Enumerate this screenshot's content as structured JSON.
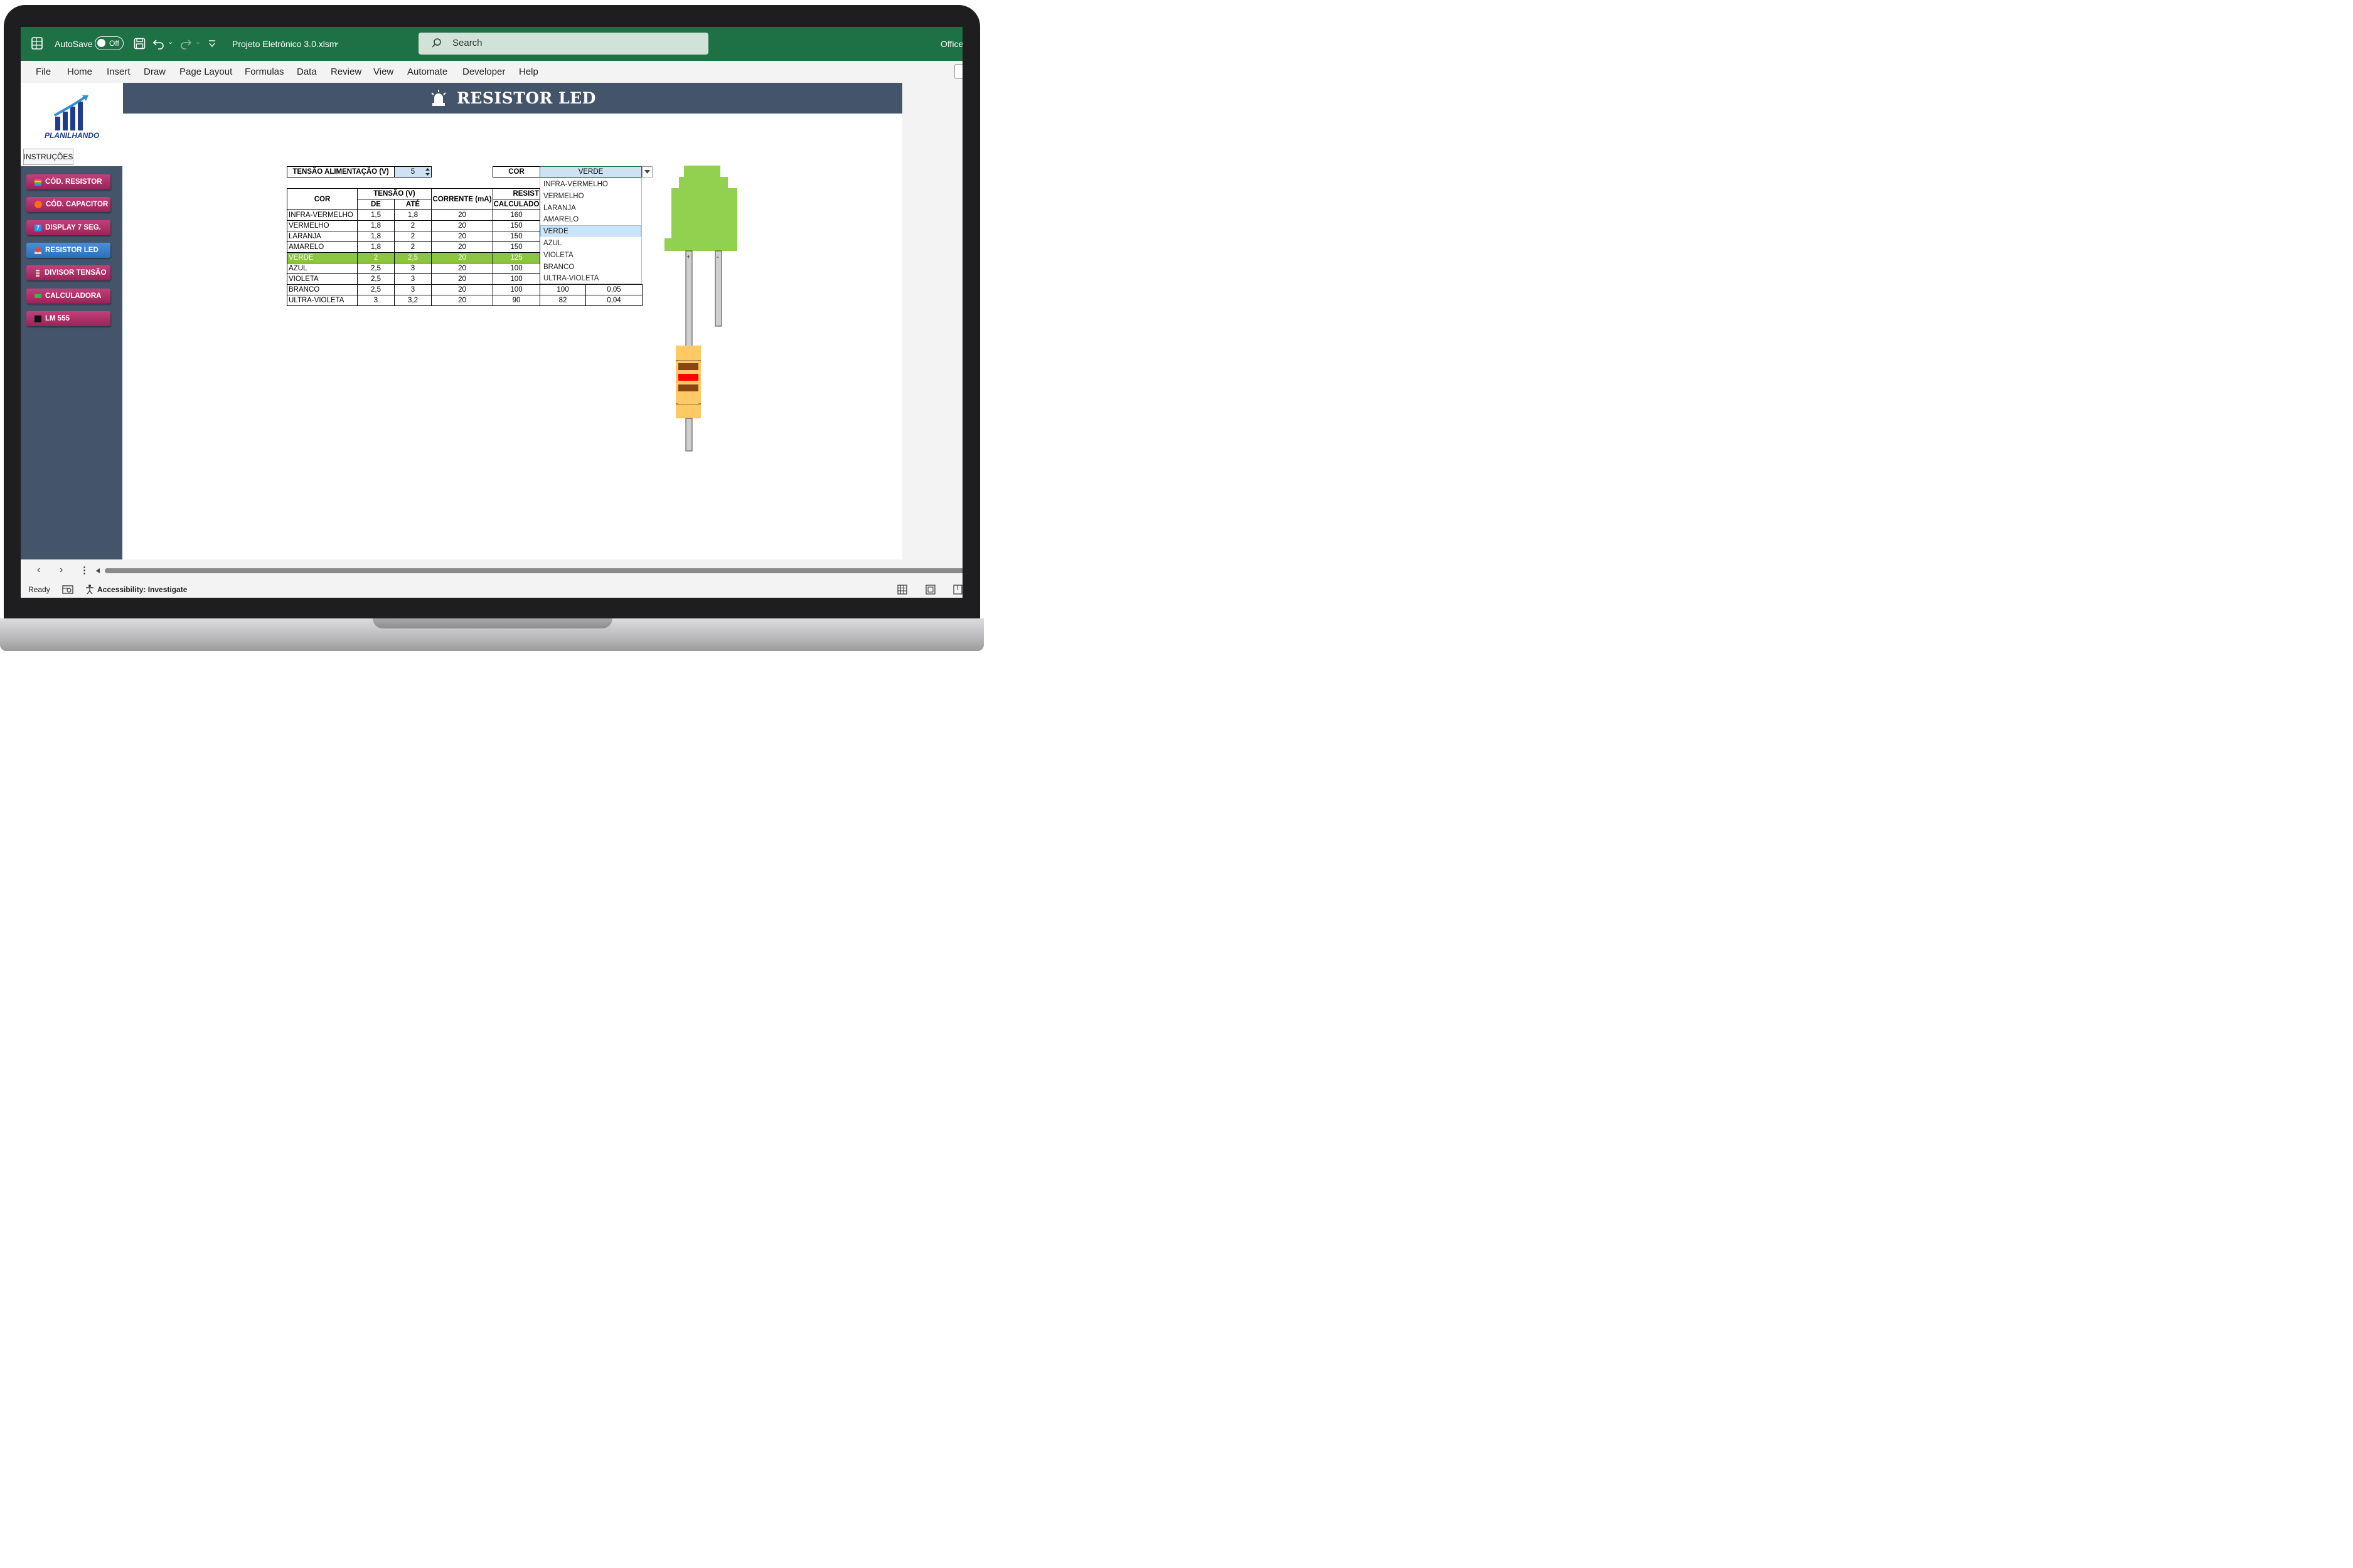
{
  "titlebar": {
    "autosave_label": "AutoSave",
    "autosave_state": "Off",
    "filename": "Projeto Eletrônico 3.0.xlsm",
    "search_placeholder": "Search",
    "account": "Office"
  },
  "menu": [
    "File",
    "Home",
    "Insert",
    "Draw",
    "Page Layout",
    "Formulas",
    "Data",
    "Review",
    "View",
    "Automate",
    "Developer",
    "Help"
  ],
  "logo_text": "PLANILHANDO",
  "instructions_button": "INSTRUÇÕES",
  "nav": [
    {
      "label": "CÓD. RESISTOR",
      "icon": "rainbow-icon"
    },
    {
      "label": "CÓD. CAPACITOR",
      "icon": "orange-dot-icon"
    },
    {
      "label": "DISPLAY 7 SEG.",
      "icon": "seven-icon",
      "icon_text": "7"
    },
    {
      "label": "RESISTOR LED",
      "icon": "siren-icon",
      "active": true
    },
    {
      "label": "DIVISOR TENSÃO",
      "icon": "resistor-icon"
    },
    {
      "label": "CALCULADORA",
      "icon": "battery-icon"
    },
    {
      "label": "LM 555",
      "icon": "chip-icon"
    }
  ],
  "header_title": "RESISTOR LED",
  "supply": {
    "label": "TENSÃO ALIMENTAÇÃO (V)",
    "value": "5"
  },
  "cor": {
    "label": "COR",
    "value": "VERDE"
  },
  "table": {
    "h_cor": "COR",
    "h_tensao": "TENSÃO (V)",
    "h_de": "DE",
    "h_ate": "ATÉ",
    "h_corrente": "CORRENTE (mA)",
    "h_resist": "RESIST",
    "h_calculado": "CALCULADO",
    "rows": [
      {
        "cor": "INFRA-VERMELHO",
        "de": "1,5",
        "ate": "1,8",
        "corrente": "20",
        "calc": "160"
      },
      {
        "cor": "VERMELHO",
        "de": "1,8",
        "ate": "2",
        "corrente": "20",
        "calc": "150"
      },
      {
        "cor": "LARANJA",
        "de": "1,8",
        "ate": "2",
        "corrente": "20",
        "calc": "150"
      },
      {
        "cor": "AMARELO",
        "de": "1,8",
        "ate": "2",
        "corrente": "20",
        "calc": "150"
      },
      {
        "cor": "VERDE",
        "de": "2",
        "ate": "2,5",
        "corrente": "20",
        "calc": "125",
        "highlight": true
      },
      {
        "cor": "AZUL",
        "de": "2,5",
        "ate": "3",
        "corrente": "20",
        "calc": "100"
      },
      {
        "cor": "VIOLETA",
        "de": "2,5",
        "ate": "3",
        "corrente": "20",
        "calc": "100"
      },
      {
        "cor": "BRANCO",
        "de": "2,5",
        "ate": "3",
        "corrente": "20",
        "calc": "100",
        "col6": "100",
        "col7": "0,05"
      },
      {
        "cor": "ULTRA-VIOLETA",
        "de": "3",
        "ate": "3,2",
        "corrente": "20",
        "calc": "90",
        "col6": "82",
        "col7": "0,04"
      }
    ]
  },
  "dropdown_options": [
    "INFRA-VERMELHO",
    "VERMELHO",
    "LARANJA",
    "AMARELO",
    "VERDE",
    "AZUL",
    "VIOLETA",
    "BRANCO",
    "ULTRA-VIOLETA"
  ],
  "dropdown_selected": "VERDE",
  "led": {
    "plus": "+",
    "minus": "-",
    "color": "#92d050"
  },
  "resistor_bands": [
    "#8b4513",
    "#ff0000",
    "#8b4513"
  ],
  "status": {
    "ready": "Ready",
    "accessibility": "Accessibility: Investigate"
  }
}
